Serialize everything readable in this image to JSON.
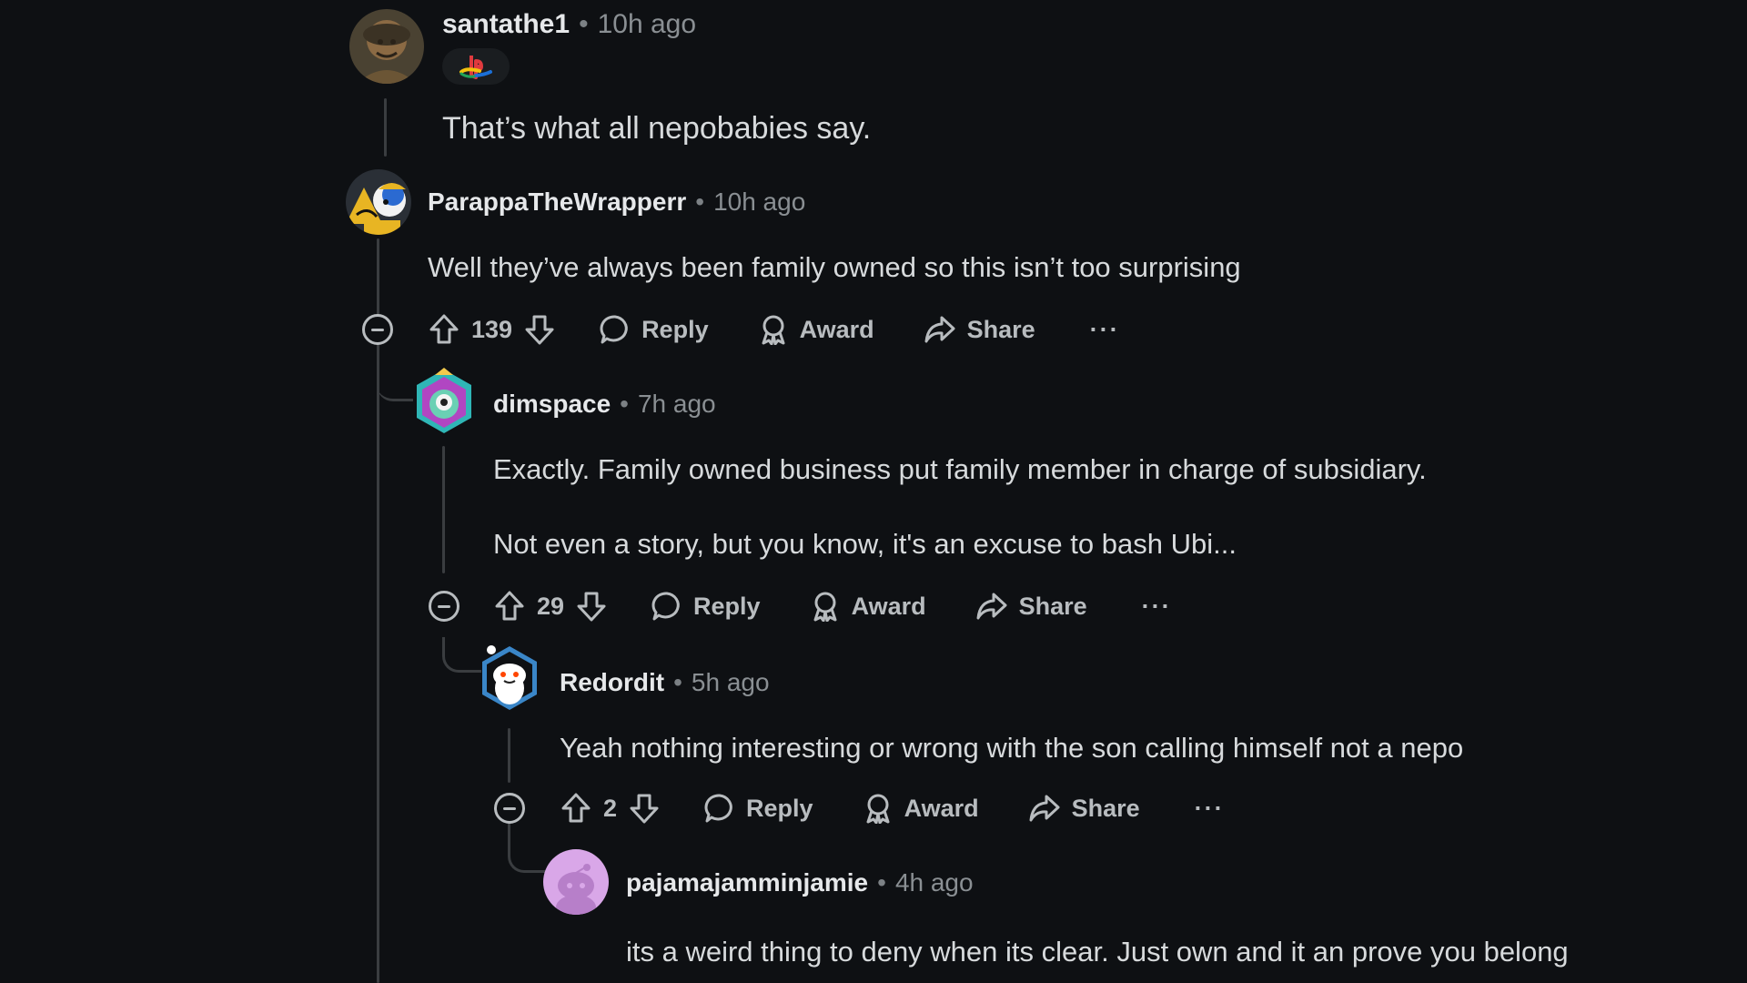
{
  "comments": [
    {
      "username": "santathe1",
      "time": "10h ago",
      "flair": "playstation-logo",
      "body": [
        "That’s what all nepobabies say."
      ]
    },
    {
      "username": "ParappaTheWrapperr",
      "time": "10h ago",
      "body": [
        "Well they’ve always been family owned so this isn’t too surprising"
      ],
      "score": "139",
      "actions": {
        "reply": "Reply",
        "award": "Award",
        "share": "Share",
        "more": "···"
      }
    },
    {
      "username": "dimspace",
      "time": "7h ago",
      "body": [
        "Exactly. Family owned business put family member in charge of subsidiary.",
        "Not even a story, but you know, it's an excuse to bash Ubi..."
      ],
      "score": "29",
      "actions": {
        "reply": "Reply",
        "award": "Award",
        "share": "Share",
        "more": "···"
      }
    },
    {
      "username": "Redordit",
      "time": "5h ago",
      "body": [
        "Yeah nothing interesting or wrong with the son calling himself not a nepo"
      ],
      "score": "2",
      "actions": {
        "reply": "Reply",
        "award": "Award",
        "share": "Share",
        "more": "···"
      }
    },
    {
      "username": "pajamajamminjamie",
      "time": "4h ago",
      "body": [
        "its a weird thing to deny when its clear. Just own and it an prove you belong"
      ]
    }
  ],
  "separator": "•",
  "colors": {
    "background": "#0e1013",
    "thread_line": "#3a3d40",
    "username": "#e6e8ea",
    "meta": "#8a8f93",
    "action": "#b8bcbf"
  }
}
